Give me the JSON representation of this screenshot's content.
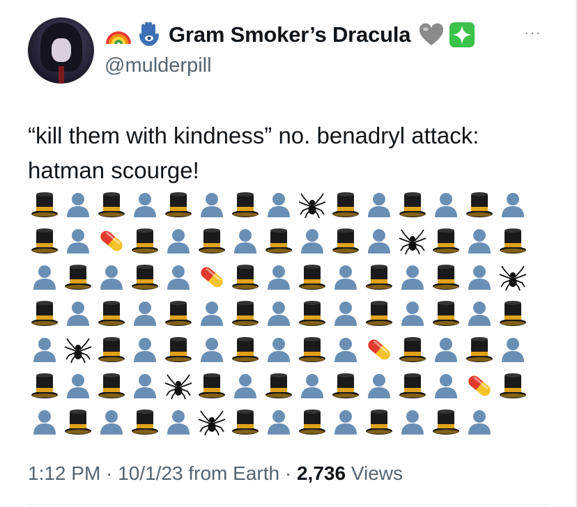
{
  "profile": {
    "display_name": "Gram Smoker’s Dracula",
    "handle": "@mulderpill",
    "badges_left": [
      "rainbow-icon",
      "hamsa-icon"
    ],
    "badges_right": [
      "grey-heart-icon",
      "sparkle-box-icon"
    ],
    "more_label": "···"
  },
  "tweet": {
    "text_line_1": "“kill them with kindness” no. benadryl attack:",
    "text_line_2": "hatman scourge!",
    "emoji_rows": [
      [
        "hat",
        "person",
        "hat",
        "person",
        "hat",
        "person",
        "hat",
        "person",
        "spider",
        "hat",
        "person",
        "hat",
        "person",
        "hat",
        "person"
      ],
      [
        "hat",
        "person",
        "pill",
        "hat",
        "person",
        "hat",
        "person",
        "hat",
        "person",
        "hat",
        "person",
        "spider",
        "hat",
        "person",
        "hat"
      ],
      [
        "person",
        "hat",
        "person",
        "hat",
        "person",
        "pill",
        "hat",
        "person",
        "hat",
        "person",
        "hat",
        "person",
        "hat",
        "person",
        "spider"
      ],
      [
        "hat",
        "person",
        "hat",
        "person",
        "hat",
        "person",
        "hat",
        "person",
        "hat",
        "person",
        "hat",
        "person",
        "hat",
        "person",
        "hat"
      ],
      [
        "person",
        "spider",
        "hat",
        "person",
        "hat",
        "person",
        "hat",
        "person",
        "hat",
        "person",
        "pill",
        "hat",
        "person",
        "hat",
        "person"
      ],
      [
        "hat",
        "person",
        "hat",
        "person",
        "spider",
        "hat",
        "person",
        "hat",
        "person",
        "hat",
        "person",
        "hat",
        "person",
        "pill",
        "hat"
      ],
      [
        "person",
        "hat",
        "person",
        "hat",
        "person",
        "spider",
        "hat",
        "person",
        "hat",
        "person",
        "hat",
        "person",
        "hat",
        "person"
      ]
    ]
  },
  "meta": {
    "time": "1:12 PM",
    "sep1": " · ",
    "date": "10/1/23",
    "location": " from Earth",
    "sep2": " · ",
    "views_count": "2,736",
    "views_label": " Views"
  },
  "colors": {
    "text": "#0f1419",
    "muted": "#536471",
    "person": "#6a8fb5",
    "hat_band": "#e0a21a",
    "pill_red": "#e23b2e",
    "pill_yellow": "#f6c22a"
  }
}
